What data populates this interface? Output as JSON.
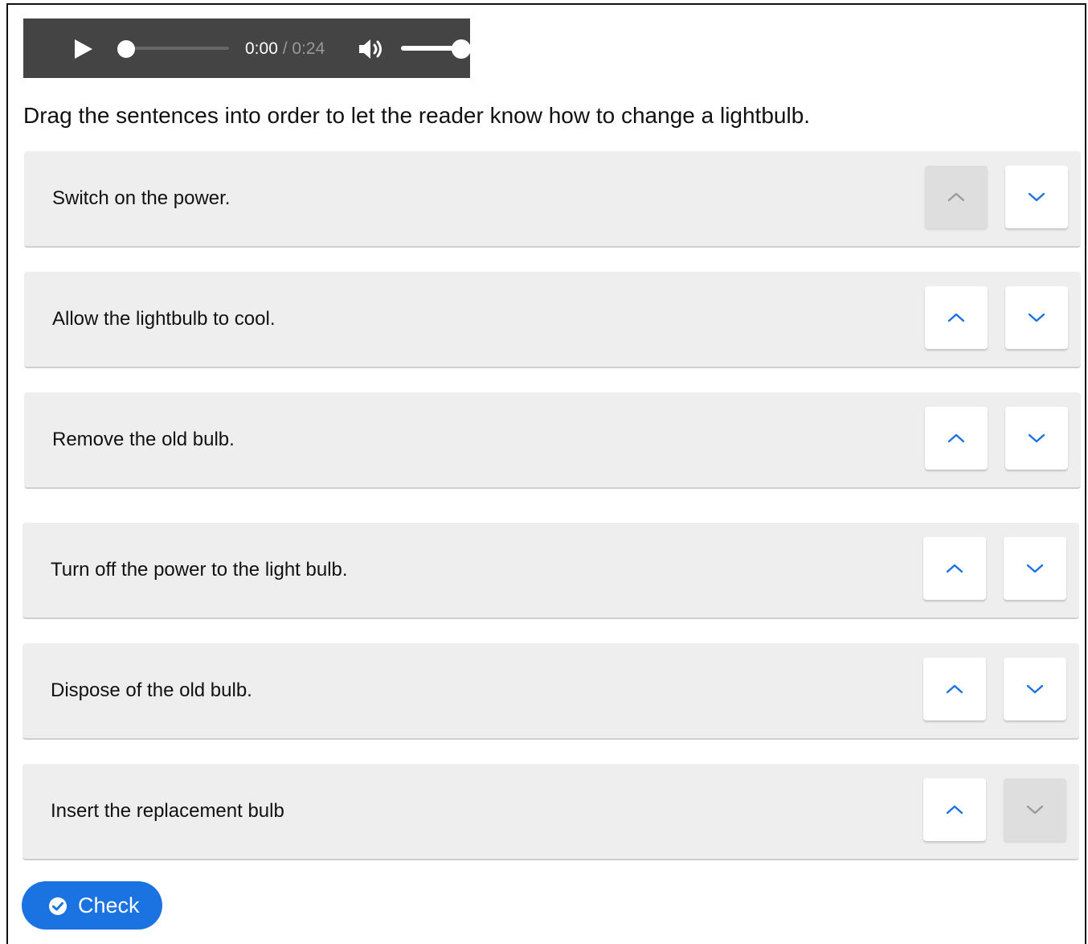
{
  "player": {
    "current_time": "0:00",
    "separator": "/",
    "duration": "0:24",
    "progress": 0.0,
    "volume": 1.0,
    "icons": {
      "play": "play-icon",
      "volume": "volume-icon"
    }
  },
  "instruction": "Drag the sentences into order to let the reader know how to change a lightbulb.",
  "items": [
    {
      "label": "Switch on the power.",
      "up_enabled": false,
      "down_enabled": true
    },
    {
      "label": "Allow the lightbulb to cool.",
      "up_enabled": true,
      "down_enabled": true
    },
    {
      "label": "Remove the old bulb.",
      "up_enabled": true,
      "down_enabled": true
    },
    {
      "label": "Turn off the power to the light bulb.",
      "up_enabled": true,
      "down_enabled": true
    },
    {
      "label": "Dispose of the old bulb.",
      "up_enabled": true,
      "down_enabled": true
    },
    {
      "label": "Insert the replacement bulb",
      "up_enabled": true,
      "down_enabled": false
    }
  ],
  "check_button": {
    "label": "Check",
    "icon": "check-circle-icon"
  },
  "colors": {
    "player_bg": "#444444",
    "item_bg": "#eeeeee",
    "accent": "#1a73e0",
    "arrow_disabled": "#9a9a9a"
  }
}
